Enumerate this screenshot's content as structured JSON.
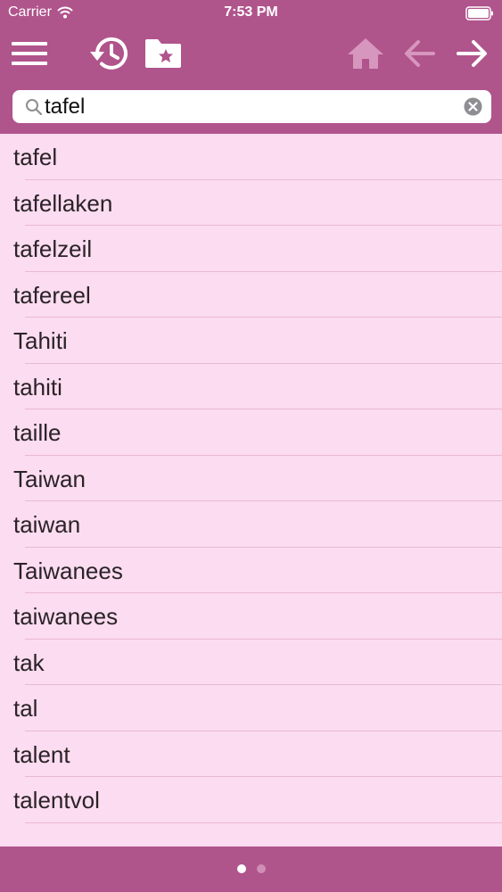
{
  "status_bar": {
    "carrier": "Carrier",
    "time": "7:53 PM",
    "icons": [
      "wifi-icon",
      "battery-icon"
    ]
  },
  "toolbar": {
    "buttons": [
      {
        "name": "menu-button",
        "icon": "hamburger-icon",
        "enabled": true
      },
      {
        "name": "history-button",
        "icon": "history-clock-icon",
        "enabled": true
      },
      {
        "name": "favorites-button",
        "icon": "folder-star-icon",
        "enabled": true
      },
      {
        "name": "home-button",
        "icon": "home-icon",
        "enabled": false
      },
      {
        "name": "back-button",
        "icon": "arrow-left-icon",
        "enabled": false
      },
      {
        "name": "forward-button",
        "icon": "arrow-right-icon",
        "enabled": true
      }
    ]
  },
  "search": {
    "value": "tafel",
    "icon": "search-icon",
    "clear_icon": "clear-icon"
  },
  "results": [
    "tafel",
    "tafellaken",
    "tafelzeil",
    "tafereel",
    "Tahiti",
    "tahiti",
    "taille",
    "Taiwan",
    "taiwan",
    "Taiwanees",
    "taiwanees",
    "tak",
    "tal",
    "talent",
    "talentvol"
  ],
  "pager": {
    "pages": 2,
    "current": 1
  },
  "colors": {
    "bar": "#b0548c",
    "list_background": "#fcdcf0",
    "separator": "#e9b8d6",
    "text": "#2a2328",
    "disabled_icon": "#d796bd",
    "dot_inactive": "#cf8fb5"
  }
}
